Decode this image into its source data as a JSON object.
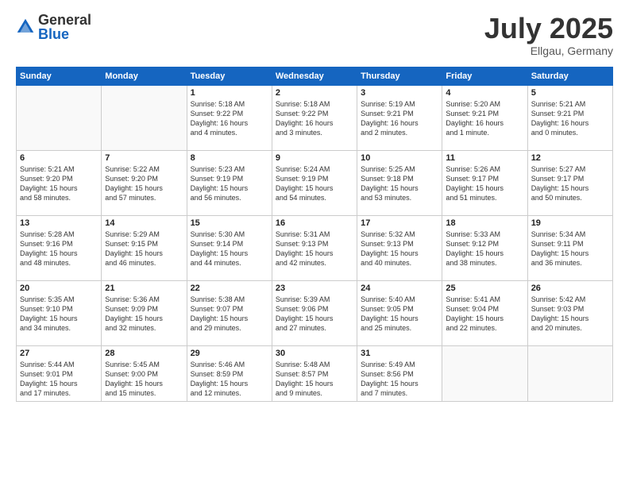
{
  "header": {
    "logo_general": "General",
    "logo_blue": "Blue",
    "month_title": "July 2025",
    "location": "Ellgau, Germany"
  },
  "weekdays": [
    "Sunday",
    "Monday",
    "Tuesday",
    "Wednesday",
    "Thursday",
    "Friday",
    "Saturday"
  ],
  "weeks": [
    [
      {
        "day": "",
        "info": ""
      },
      {
        "day": "",
        "info": ""
      },
      {
        "day": "1",
        "info": "Sunrise: 5:18 AM\nSunset: 9:22 PM\nDaylight: 16 hours\nand 4 minutes."
      },
      {
        "day": "2",
        "info": "Sunrise: 5:18 AM\nSunset: 9:22 PM\nDaylight: 16 hours\nand 3 minutes."
      },
      {
        "day": "3",
        "info": "Sunrise: 5:19 AM\nSunset: 9:21 PM\nDaylight: 16 hours\nand 2 minutes."
      },
      {
        "day": "4",
        "info": "Sunrise: 5:20 AM\nSunset: 9:21 PM\nDaylight: 16 hours\nand 1 minute."
      },
      {
        "day": "5",
        "info": "Sunrise: 5:21 AM\nSunset: 9:21 PM\nDaylight: 16 hours\nand 0 minutes."
      }
    ],
    [
      {
        "day": "6",
        "info": "Sunrise: 5:21 AM\nSunset: 9:20 PM\nDaylight: 15 hours\nand 58 minutes."
      },
      {
        "day": "7",
        "info": "Sunrise: 5:22 AM\nSunset: 9:20 PM\nDaylight: 15 hours\nand 57 minutes."
      },
      {
        "day": "8",
        "info": "Sunrise: 5:23 AM\nSunset: 9:19 PM\nDaylight: 15 hours\nand 56 minutes."
      },
      {
        "day": "9",
        "info": "Sunrise: 5:24 AM\nSunset: 9:19 PM\nDaylight: 15 hours\nand 54 minutes."
      },
      {
        "day": "10",
        "info": "Sunrise: 5:25 AM\nSunset: 9:18 PM\nDaylight: 15 hours\nand 53 minutes."
      },
      {
        "day": "11",
        "info": "Sunrise: 5:26 AM\nSunset: 9:17 PM\nDaylight: 15 hours\nand 51 minutes."
      },
      {
        "day": "12",
        "info": "Sunrise: 5:27 AM\nSunset: 9:17 PM\nDaylight: 15 hours\nand 50 minutes."
      }
    ],
    [
      {
        "day": "13",
        "info": "Sunrise: 5:28 AM\nSunset: 9:16 PM\nDaylight: 15 hours\nand 48 minutes."
      },
      {
        "day": "14",
        "info": "Sunrise: 5:29 AM\nSunset: 9:15 PM\nDaylight: 15 hours\nand 46 minutes."
      },
      {
        "day": "15",
        "info": "Sunrise: 5:30 AM\nSunset: 9:14 PM\nDaylight: 15 hours\nand 44 minutes."
      },
      {
        "day": "16",
        "info": "Sunrise: 5:31 AM\nSunset: 9:13 PM\nDaylight: 15 hours\nand 42 minutes."
      },
      {
        "day": "17",
        "info": "Sunrise: 5:32 AM\nSunset: 9:13 PM\nDaylight: 15 hours\nand 40 minutes."
      },
      {
        "day": "18",
        "info": "Sunrise: 5:33 AM\nSunset: 9:12 PM\nDaylight: 15 hours\nand 38 minutes."
      },
      {
        "day": "19",
        "info": "Sunrise: 5:34 AM\nSunset: 9:11 PM\nDaylight: 15 hours\nand 36 minutes."
      }
    ],
    [
      {
        "day": "20",
        "info": "Sunrise: 5:35 AM\nSunset: 9:10 PM\nDaylight: 15 hours\nand 34 minutes."
      },
      {
        "day": "21",
        "info": "Sunrise: 5:36 AM\nSunset: 9:09 PM\nDaylight: 15 hours\nand 32 minutes."
      },
      {
        "day": "22",
        "info": "Sunrise: 5:38 AM\nSunset: 9:07 PM\nDaylight: 15 hours\nand 29 minutes."
      },
      {
        "day": "23",
        "info": "Sunrise: 5:39 AM\nSunset: 9:06 PM\nDaylight: 15 hours\nand 27 minutes."
      },
      {
        "day": "24",
        "info": "Sunrise: 5:40 AM\nSunset: 9:05 PM\nDaylight: 15 hours\nand 25 minutes."
      },
      {
        "day": "25",
        "info": "Sunrise: 5:41 AM\nSunset: 9:04 PM\nDaylight: 15 hours\nand 22 minutes."
      },
      {
        "day": "26",
        "info": "Sunrise: 5:42 AM\nSunset: 9:03 PM\nDaylight: 15 hours\nand 20 minutes."
      }
    ],
    [
      {
        "day": "27",
        "info": "Sunrise: 5:44 AM\nSunset: 9:01 PM\nDaylight: 15 hours\nand 17 minutes."
      },
      {
        "day": "28",
        "info": "Sunrise: 5:45 AM\nSunset: 9:00 PM\nDaylight: 15 hours\nand 15 minutes."
      },
      {
        "day": "29",
        "info": "Sunrise: 5:46 AM\nSunset: 8:59 PM\nDaylight: 15 hours\nand 12 minutes."
      },
      {
        "day": "30",
        "info": "Sunrise: 5:48 AM\nSunset: 8:57 PM\nDaylight: 15 hours\nand 9 minutes."
      },
      {
        "day": "31",
        "info": "Sunrise: 5:49 AM\nSunset: 8:56 PM\nDaylight: 15 hours\nand 7 minutes."
      },
      {
        "day": "",
        "info": ""
      },
      {
        "day": "",
        "info": ""
      }
    ]
  ]
}
